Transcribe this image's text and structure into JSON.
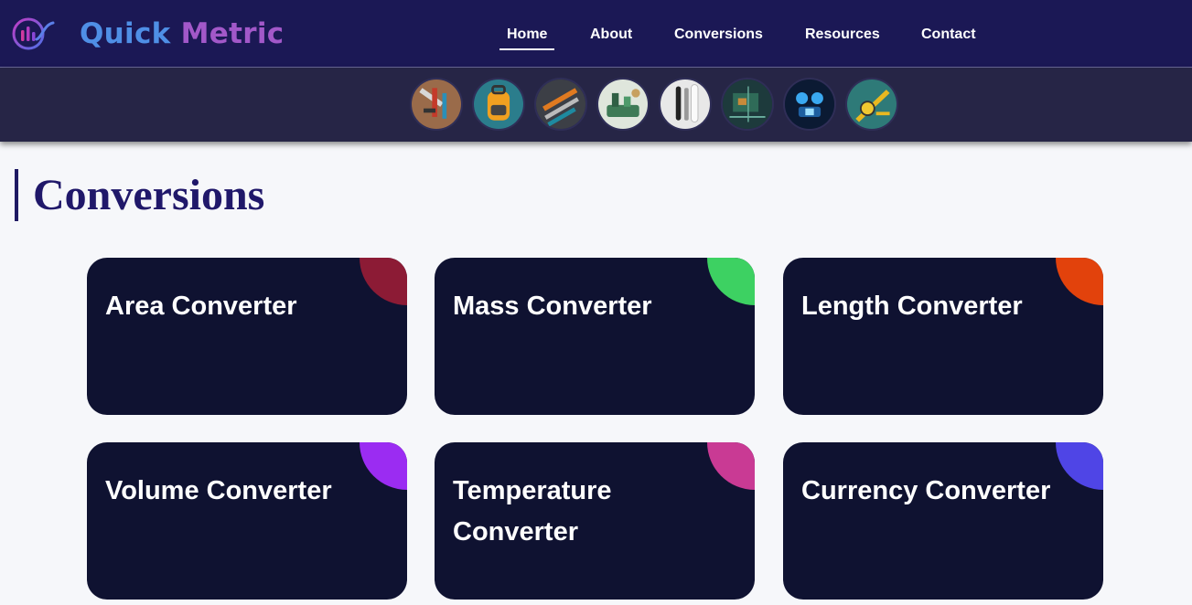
{
  "brand": {
    "name_part1": "Quick",
    "name_part2": "Metric",
    "logo_icon": "chart-bars-logo-icon",
    "colors": {
      "part1": "#4f8fe6",
      "part2": "#a258c9"
    }
  },
  "nav": {
    "items": [
      {
        "label": "Home",
        "active": true
      },
      {
        "label": "About",
        "active": false
      },
      {
        "label": "Conversions",
        "active": false
      },
      {
        "label": "Resources",
        "active": false
      },
      {
        "label": "Contact",
        "active": false
      }
    ]
  },
  "strip": {
    "thumbnails": [
      {
        "icon": "tools-thumbnail"
      },
      {
        "icon": "backpack-thumbnail"
      },
      {
        "icon": "instruments-thumbnail"
      },
      {
        "icon": "scale-thumbnail"
      },
      {
        "icon": "thermometer-thumbnail"
      },
      {
        "icon": "circuit-board-thumbnail"
      },
      {
        "icon": "robot-thumbnail"
      },
      {
        "icon": "protractor-thumbnail"
      }
    ]
  },
  "page": {
    "title": "Conversions"
  },
  "cards": [
    {
      "title": "Area Converter",
      "accent": "#8c1b35"
    },
    {
      "title": "Mass Converter",
      "accent": "#3dd162"
    },
    {
      "title": "Length Converter",
      "accent": "#e2420c"
    },
    {
      "title": "Volume Converter",
      "accent": "#9b2cf2"
    },
    {
      "title": "Temperature Converter",
      "accent": "#c93a94"
    },
    {
      "title": "Currency Converter",
      "accent": "#4f45e6"
    }
  ],
  "colors": {
    "header_bg": "#1b1855",
    "strip_bg": "#262546",
    "page_bg": "#f6f7fa",
    "card_bg": "#0f1231",
    "title_color": "#20186a"
  }
}
